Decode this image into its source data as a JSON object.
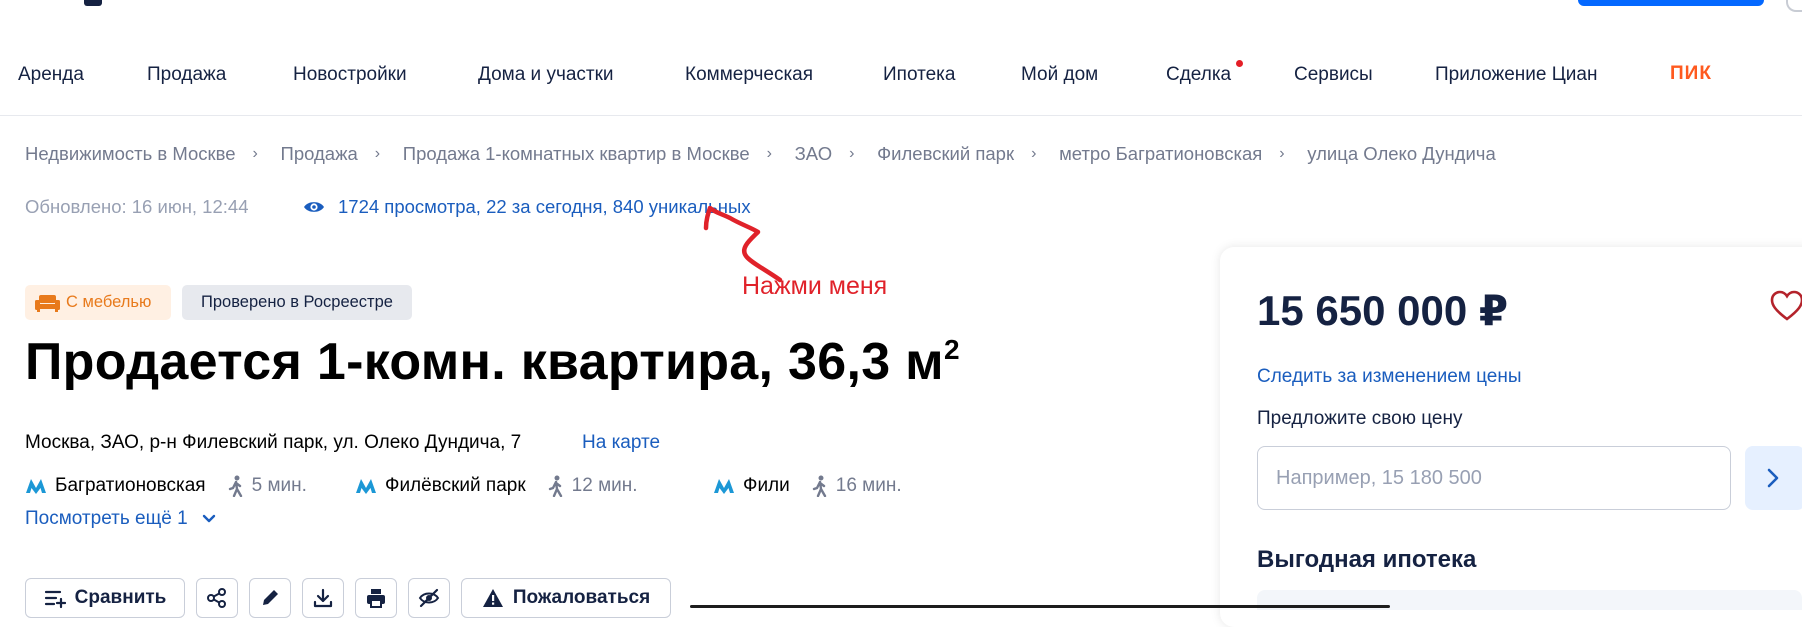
{
  "nav": {
    "items": [
      {
        "label": "Аренда"
      },
      {
        "label": "Продажа"
      },
      {
        "label": "Новостройки"
      },
      {
        "label": "Дома и участки"
      },
      {
        "label": "Коммерческая"
      },
      {
        "label": "Ипотека"
      },
      {
        "label": "Мой дом"
      },
      {
        "label": "Сделка",
        "has_dot": true
      },
      {
        "label": "Сервисы"
      },
      {
        "label": "Приложение Циан"
      }
    ],
    "partner_logo": "ПИК"
  },
  "breadcrumbs": [
    "Недвижимость в Москве",
    "Продажа",
    "Продажа 1-комнатных квартир в Москве",
    "ЗАО",
    "Филевский парк",
    "метро Багратионовская",
    "улица Олеко Дундича"
  ],
  "meta": {
    "updated": "Обновлено: 16 июн, 12:44",
    "views": "1724 просмотра, 22 за сегодня, 840 уникальных"
  },
  "annotation": {
    "text": "Нажми меня",
    "color": "#e0222a"
  },
  "badges": {
    "furniture": "С мебелью",
    "verified": "Проверено в Росреестре"
  },
  "listing": {
    "title": "Продается 1-комн. квартира, 36,3 м",
    "title_sup": "2",
    "address": "Москва, ЗАО, р-н Филевский парк, ул. Олеко Дундича, 7",
    "map_link": "На карте",
    "metro": [
      {
        "station": "Багратионовская",
        "time": "5 мин."
      },
      {
        "station": "Филёвский парк",
        "time": "12 мин."
      },
      {
        "station": "Фили",
        "time": "16 мин."
      }
    ],
    "more_link": "Посмотреть ещё 1"
  },
  "toolbar": {
    "compare": "Сравнить",
    "complain": "Пожаловаться"
  },
  "card": {
    "price": "15 650 000 ₽",
    "follow_price": "Следить за изменением цены",
    "offer_label": "Предложите свою цену",
    "offer_placeholder": "Например, 15 180 500",
    "mortgage_title": "Выгодная ипотека"
  },
  "colors": {
    "accent": "#1a5dbe",
    "text": "#152242",
    "muted": "#737a8e",
    "metro": "#1c98d6",
    "pik": "#ff5a1f"
  }
}
